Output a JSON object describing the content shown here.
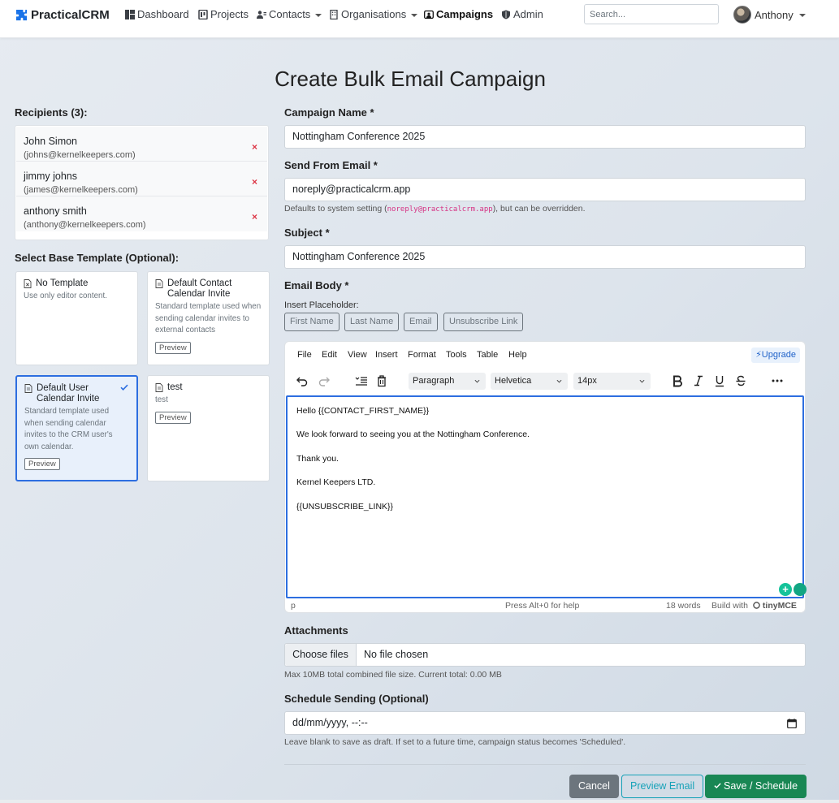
{
  "nav": {
    "brand": "PracticalCRM",
    "items": [
      {
        "label": "Dashboard",
        "icon": "dashboard-icon"
      },
      {
        "label": "Projects",
        "icon": "projects-icon"
      },
      {
        "label": "Contacts",
        "icon": "contacts-icon",
        "dropdown": true
      },
      {
        "label": "Organisations",
        "icon": "building-icon",
        "dropdown": true
      },
      {
        "label": "Campaigns",
        "icon": "campaigns-icon",
        "active": true
      },
      {
        "label": "Admin",
        "icon": "shield-icon"
      }
    ],
    "search_placeholder": "Search...",
    "user_name": "Anthony"
  },
  "page_title": "Create Bulk Email Campaign",
  "recipients": {
    "label": "Recipients (3):",
    "items": [
      {
        "name": "John Simon",
        "email": "(johns@kernelkeepers.com)"
      },
      {
        "name": "jimmy johns",
        "email": "(james@kernelkeepers.com)"
      },
      {
        "name": "anthony smith",
        "email": "(anthony@kernelkeepers.com)"
      }
    ],
    "remove_glyph": "×"
  },
  "templates": {
    "label": "Select Base Template (Optional):",
    "items": [
      {
        "name": "No Template",
        "description": "Use only editor content.",
        "preview": ""
      },
      {
        "name": "Default Contact Calendar Invite",
        "description": "Standard template used when sending calendar invites to external contacts",
        "preview": "Preview"
      },
      {
        "name": "Default User Calendar Invite",
        "description": "Standard template used when sending calendar invites to the CRM user's own calendar.",
        "preview": "Preview",
        "selected": true
      },
      {
        "name": "test",
        "description": "test",
        "preview": "Preview"
      }
    ]
  },
  "form": {
    "campaign_name_label": "Campaign Name *",
    "campaign_name_value": "Nottingham Conference 2025",
    "send_from_label": "Send From Email *",
    "send_from_value": "noreply@practicalcrm.app",
    "send_from_help_pre": "Defaults to system setting (",
    "send_from_help_code": "noreply@practicalcrm.app",
    "send_from_help_post": "), but can be overridden.",
    "subject_label": "Subject *",
    "subject_value": "Nottingham Conference 2025",
    "body_label": "Email Body *",
    "placeholder_label": "Insert Placeholder:",
    "placeholders": [
      "First Name",
      "Last Name",
      "Email",
      "Unsubscribe Link"
    ]
  },
  "editor": {
    "menu": [
      "File",
      "Edit",
      "View",
      "Insert",
      "Format",
      "Table",
      "Help"
    ],
    "tools_label": "Tools",
    "upgrade": "⚡Upgrade",
    "block_format": "Paragraph",
    "font_family": "Helvetica",
    "font_size": "14px",
    "body_lines": [
      "Hello {{CONTACT_FIRST_NAME}}",
      "We look forward to seeing you at the Nottingham Conference.",
      "Thank you.",
      "Kernel Keepers LTD.",
      "{{UNSUBSCRIBE_LINK}}"
    ],
    "status_path": "p",
    "status_help": "Press Alt+0 for help",
    "word_count": "18 words",
    "built_with": "Build with",
    "tiny_brand": "tinyMCE"
  },
  "attachments": {
    "label": "Attachments",
    "button": "Choose files",
    "status": "No file chosen",
    "help": "Max 10MB total combined file size. Current total: 0.00 MB"
  },
  "schedule": {
    "label": "Schedule Sending (Optional)",
    "placeholder": "dd/mm/yyyy, --:--",
    "help": "Leave blank to save as draft. If set to a future time, campaign status becomes 'Scheduled'."
  },
  "actions": {
    "cancel": "Cancel",
    "preview": "Preview Email",
    "save": "Save / Schedule",
    "save_icon": "check-icon"
  },
  "colors": {
    "primary": "#2d6ee0",
    "danger": "#dc3545",
    "success": "#198754",
    "info": "#17a2b8",
    "secondary": "#6c757d"
  }
}
